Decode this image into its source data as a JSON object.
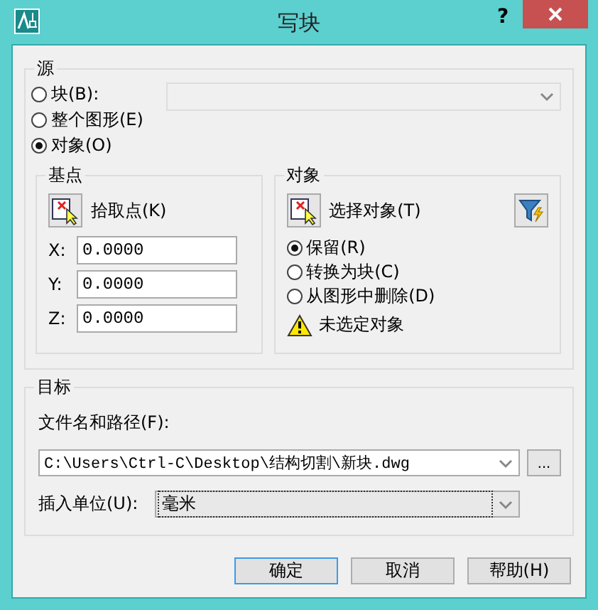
{
  "window": {
    "title": "写块",
    "help": "?"
  },
  "source": {
    "label": "源",
    "options": [
      {
        "label": "块(B):",
        "selected": false
      },
      {
        "label": "整个图形(E)",
        "selected": false
      },
      {
        "label": "对象(O)",
        "selected": true
      }
    ],
    "block_dropdown": {
      "disabled": true
    }
  },
  "base_point": {
    "label": "基点",
    "pick_button": "拾取点(K)",
    "fields": [
      {
        "label": "X:",
        "value": "0.0000"
      },
      {
        "label": "Y:",
        "value": "0.0000"
      },
      {
        "label": "Z:",
        "value": "0.0000"
      }
    ]
  },
  "objects": {
    "label": "对象",
    "select_button": "选择对象(T)",
    "options": [
      {
        "label": "保留(R)",
        "selected": true
      },
      {
        "label": "转换为块(C)",
        "selected": false
      },
      {
        "label": "从图形中删除(D)",
        "selected": false
      }
    ],
    "warning": "未选定对象"
  },
  "target": {
    "label": "目标",
    "file_label": "文件名和路径(F):",
    "file_path": "C:\\Users\\Ctrl-C\\Desktop\\结构切割\\新块.dwg",
    "browse": "...",
    "units_label": "插入单位(U):",
    "units": "毫米"
  },
  "buttons": [
    {
      "label": "确定",
      "default": true
    },
    {
      "label": "取消",
      "default": false
    },
    {
      "label": "帮助(H)",
      "default": false
    }
  ]
}
